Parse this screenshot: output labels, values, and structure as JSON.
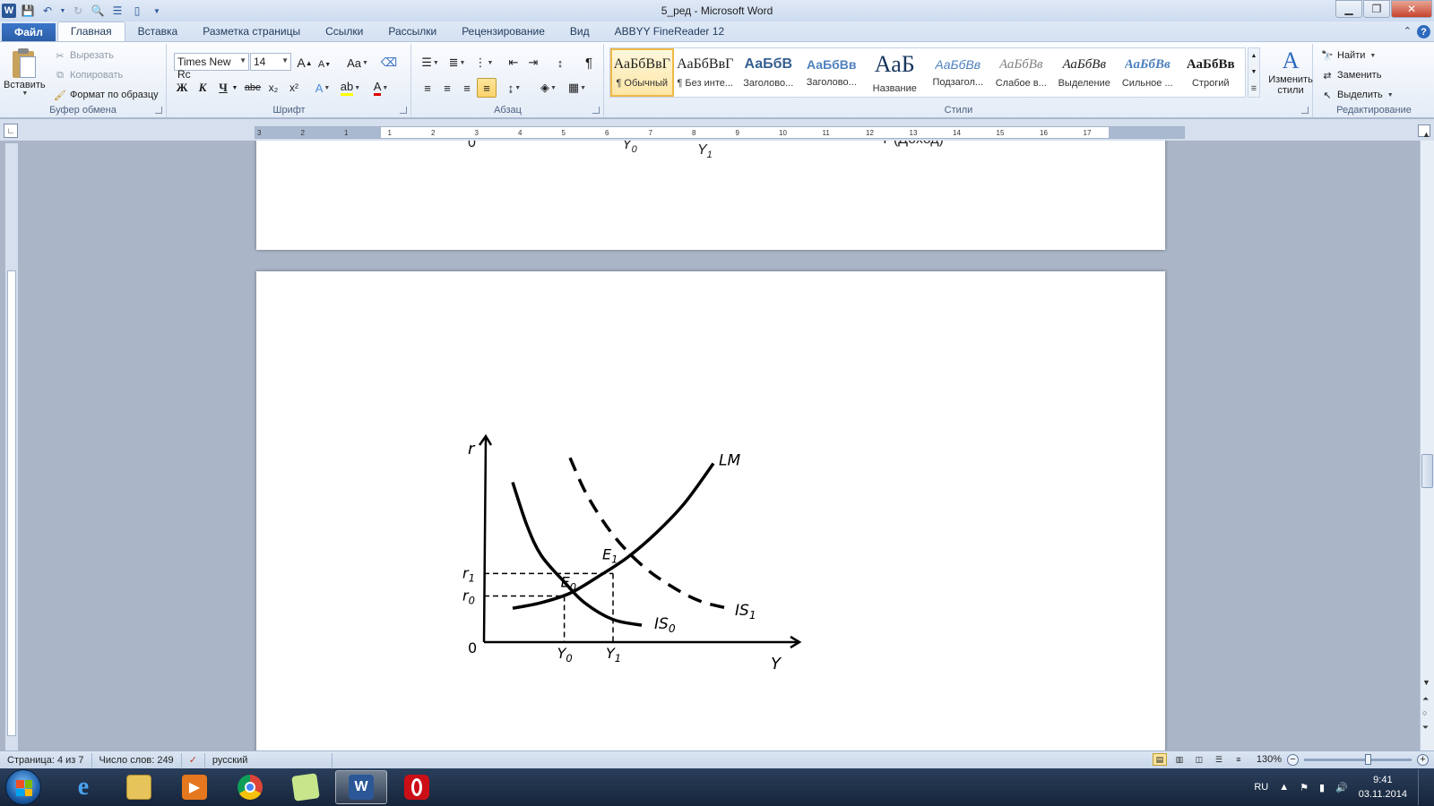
{
  "window": {
    "title": "5_ред - Microsoft Word",
    "controls": {
      "minimize": "▁",
      "maximize": "❐",
      "close": "✕"
    }
  },
  "tabs": [
    {
      "label": "Файл",
      "kind": "file"
    },
    {
      "label": "Главная",
      "kind": "active"
    },
    {
      "label": "Вставка"
    },
    {
      "label": "Разметка страницы"
    },
    {
      "label": "Ссылки"
    },
    {
      "label": "Рассылки"
    },
    {
      "label": "Рецензирование"
    },
    {
      "label": "Вид"
    },
    {
      "label": "ABBYY FineReader 12"
    }
  ],
  "ribbon": {
    "clipboard": {
      "label": "Буфер обмена",
      "paste": "Вставить",
      "cut": "Вырезать",
      "copy": "Копировать",
      "format_painter": "Формат по образцу"
    },
    "font": {
      "label": "Шрифт",
      "font_name": "Times New Rc",
      "font_size": "14",
      "bold": "Ж",
      "italic": "К",
      "underline": "Ч",
      "strike": "abe",
      "subscript": "x₂",
      "superscript": "x²",
      "grow": "A",
      "shrink": "A",
      "case": "Aa",
      "color_letter": "A"
    },
    "paragraph": {
      "label": "Абзац",
      "pilcrow": "¶"
    },
    "styles": {
      "label": "Стили",
      "items": [
        {
          "sample": "АаБбВвГ",
          "name": "¶ Обычный",
          "active": true
        },
        {
          "sample": "АаБбВвГ",
          "name": "¶ Без инте..."
        },
        {
          "sample": "АаБбВ",
          "name": "Заголово..."
        },
        {
          "sample": "АаБбВв",
          "name": "Заголово..."
        },
        {
          "sample": "АаБ",
          "name": "Название"
        },
        {
          "sample": "АаБбВв",
          "name": "Подзагол..."
        },
        {
          "sample": "АаБбВв",
          "name": "Слабое в..."
        },
        {
          "sample": "АаБбВв",
          "name": "Выделение"
        },
        {
          "sample": "АаБбВв",
          "name": "Сильное ..."
        },
        {
          "sample": "АаБбВв",
          "name": "Строгий"
        }
      ],
      "change_styles": "Изменить стили"
    },
    "editing": {
      "label": "Редактирование",
      "find": "Найти",
      "replace": "Заменить",
      "select": "Выделить"
    }
  },
  "ruler": {
    "ticks": [
      "3",
      "2",
      "1",
      "1",
      "2",
      "3",
      "4",
      "5",
      "6",
      "7",
      "8",
      "9",
      "10",
      "11",
      "12",
      "13",
      "14",
      "15",
      "16",
      "17"
    ]
  },
  "document": {
    "page1_fragment": {
      "zero": "0",
      "y0": "Y",
      "y0_sub": "0",
      "y1": "Y",
      "y1_sub": "1",
      "axis": "Y (Доход)"
    }
  },
  "chart_data": {
    "type": "line",
    "title": "",
    "xlabel": "Y",
    "ylabel": "r",
    "origin_label": "0",
    "xlim": [
      0,
      10
    ],
    "ylim": [
      0,
      10
    ],
    "series": [
      {
        "name": "LM",
        "style": "solid",
        "x": [
          1,
          2,
          3,
          4,
          5,
          6,
          7,
          8
        ],
        "y": [
          1.8,
          2.1,
          2.6,
          3.5,
          4.5,
          5.8,
          7.4,
          9.5
        ]
      },
      {
        "name": "IS0",
        "style": "solid",
        "x": [
          1,
          1.5,
          2,
          2.8,
          3.5,
          4.5,
          5.5
        ],
        "y": [
          8.5,
          6.2,
          4.6,
          3.2,
          2.1,
          1.2,
          0.9
        ]
      },
      {
        "name": "IS1",
        "style": "dashed",
        "x": [
          3,
          3.6,
          4.5,
          5.5,
          6.5,
          7.5,
          8.5
        ],
        "y": [
          9.8,
          7.8,
          5.7,
          4.1,
          3.0,
          2.2,
          1.8
        ]
      }
    ],
    "points": [
      {
        "name": "E0",
        "label": "E",
        "sub": "0",
        "x": 2.8,
        "y": 2.45
      },
      {
        "name": "E1",
        "label": "E",
        "sub": "1",
        "x": 4.5,
        "y": 3.65
      }
    ],
    "x_ticks": [
      {
        "label": "Y",
        "sub": "0",
        "x": 2.8
      },
      {
        "label": "Y",
        "sub": "1",
        "x": 4.5
      }
    ],
    "y_ticks": [
      {
        "label": "r",
        "sub": "0",
        "y": 2.45
      },
      {
        "label": "r",
        "sub": "1",
        "y": 3.65
      }
    ],
    "curve_labels": [
      {
        "text": "LM",
        "sub": ""
      },
      {
        "text": "IS",
        "sub": "1"
      },
      {
        "text": "IS",
        "sub": "0"
      }
    ],
    "grid": false,
    "legend": "none"
  },
  "statusbar": {
    "page": "Страница: 4 из 7",
    "words": "Число слов: 249",
    "language": "русский",
    "zoom": "130%"
  },
  "taskbar": {
    "language": "RU",
    "time": "9:41",
    "date": "03.11.2014"
  }
}
